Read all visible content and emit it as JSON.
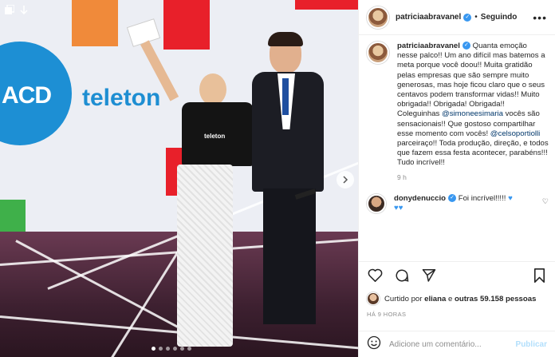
{
  "post": {
    "username": "patriciaabravanel",
    "follow_label": "Seguindo",
    "more_label": "•••",
    "caption": "Quanta emoção nesse palco!! Um ano difícil mas batemos a meta porque você doou!! Muita gratidão pelas empresas que são sempre muito generosas, mas hoje ficou claro que o seus centavos podem transformar vidas!! Muito obrigada!! Obrigada! Obrigada!! Coleguinhas",
    "mention_1": "@simoneesimaria",
    "caption_mid": " vocês são sensacionais!! Que gostoso compartilhar esse momento com vocês!",
    "mention_2": "@celsoportiolli",
    "caption_end": " parceiraço!! Toda produção, direção, e todos que fazem essa festa acontecer, parabéns!!! Tudo incrível!!",
    "caption_time": "9 h",
    "comment": {
      "username": "donydenuccio",
      "text": "Foi incrível!!!!!"
    },
    "liked_by_prefix": "Curtido por",
    "liked_by_user": "eliana",
    "liked_by_conj": " e ",
    "liked_by_others": "outras 59.158 pessoas",
    "date": "HÁ 9 HORAS",
    "comment_placeholder": "Adicione um comentário...",
    "publish_label": "Publicar"
  },
  "photo": {
    "logo_text": "ACD",
    "brand_text": "teleton",
    "shirt_text": "teleton"
  },
  "colors": {
    "accent": "#3897f0",
    "publish_disabled": "#b2dffc",
    "brand_blue": "#1d8fd4"
  }
}
